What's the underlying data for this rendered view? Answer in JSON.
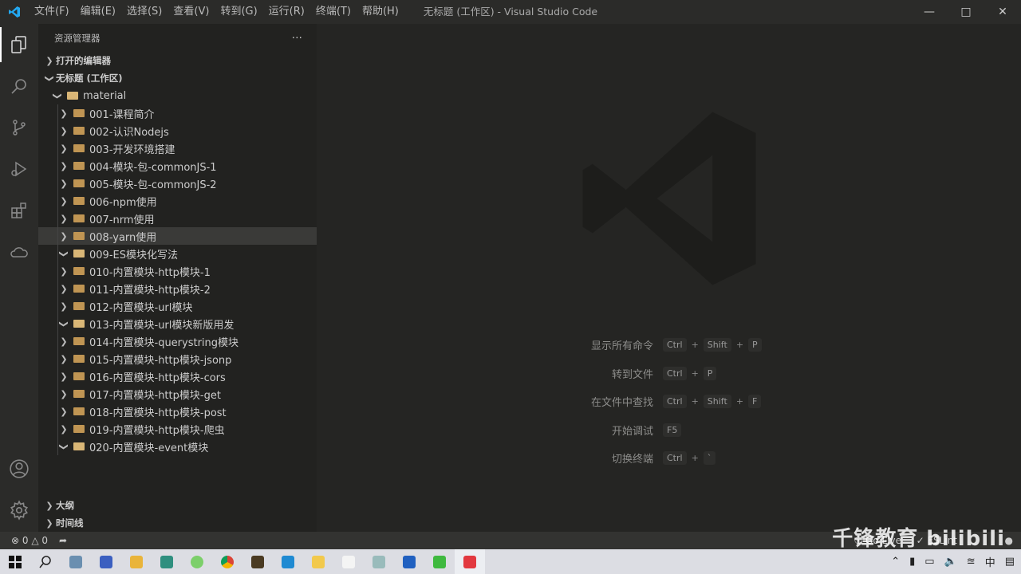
{
  "titlebar": {
    "title": "无标题 (工作区) - Visual Studio Code",
    "menu": [
      "文件(F)",
      "编辑(E)",
      "选择(S)",
      "查看(V)",
      "转到(G)",
      "运行(R)",
      "终端(T)",
      "帮助(H)"
    ]
  },
  "sidebar": {
    "header": "资源管理器",
    "more": "···",
    "open_editors": "打开的编辑器",
    "workspace": "无标题 (工作区)",
    "root": "material",
    "folders": [
      {
        "name": "001-课程简介",
        "expanded": false
      },
      {
        "name": "002-认识Nodejs",
        "expanded": false
      },
      {
        "name": "003-开发环境搭建",
        "expanded": false
      },
      {
        "name": "004-模块-包-commonJS-1",
        "expanded": false
      },
      {
        "name": "005-模块-包-commonJS-2",
        "expanded": false
      },
      {
        "name": "006-npm使用",
        "expanded": false
      },
      {
        "name": "007-nrm使用",
        "expanded": false
      },
      {
        "name": "008-yarn使用",
        "expanded": false,
        "selected": true
      },
      {
        "name": "009-ES模块化写法",
        "expanded": true
      },
      {
        "name": "010-内置模块-http模块-1",
        "expanded": false
      },
      {
        "name": "011-内置模块-http模块-2",
        "expanded": false
      },
      {
        "name": "012-内置模块-url模块",
        "expanded": false
      },
      {
        "name": "013-内置模块-url模块新版用发",
        "expanded": true
      },
      {
        "name": "014-内置模块-querystring模块",
        "expanded": false
      },
      {
        "name": "015-内置模块-http模块-jsonp",
        "expanded": false
      },
      {
        "name": "016-内置模块-http模块-cors",
        "expanded": false
      },
      {
        "name": "017-内置模块-http模块-get",
        "expanded": false
      },
      {
        "name": "018-内置模块-http模块-post",
        "expanded": false
      },
      {
        "name": "019-内置模块-http模块-爬虫",
        "expanded": false
      },
      {
        "name": "020-内置模块-event模块",
        "expanded": true
      }
    ],
    "outline": "大纲",
    "timeline": "时间线"
  },
  "editor": {
    "shortcuts": [
      {
        "label": "显示所有命令",
        "keys": [
          "Ctrl",
          "Shift",
          "P"
        ]
      },
      {
        "label": "转到文件",
        "keys": [
          "Ctrl",
          "P"
        ]
      },
      {
        "label": "在文件中查找",
        "keys": [
          "Ctrl",
          "Shift",
          "F"
        ]
      },
      {
        "label": "开始调试",
        "keys": [
          "F5"
        ]
      },
      {
        "label": "切换终端",
        "keys": [
          "Ctrl",
          "`"
        ]
      }
    ]
  },
  "status": {
    "errors": "0",
    "warnings": "0",
    "golive": "Go Live",
    "eslint": "ESLint"
  },
  "watermark": "千锋教育 bilibili",
  "tray": {
    "ime": "中"
  },
  "colors": {
    "accent": "#007acc",
    "selected_row": "#3a3a38",
    "folder": "#c09553"
  }
}
